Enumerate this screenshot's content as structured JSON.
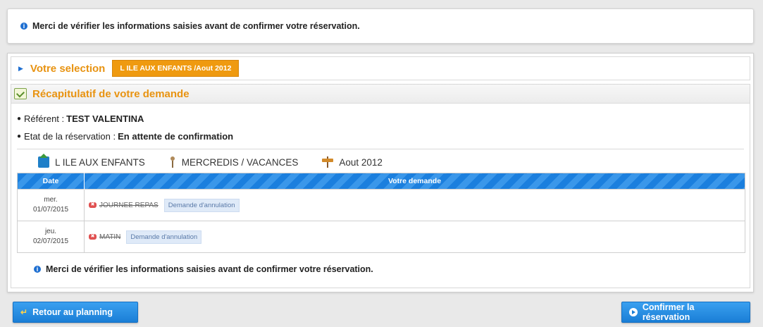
{
  "notices": {
    "top": "Merci de vérifier les informations saisies avant de confirmer votre réservation.",
    "bottom": "Merci de vérifier les informations saisies avant de confirmer votre réservation."
  },
  "selection": {
    "label": "Votre selection",
    "badge": "L ILE AUX ENFANTS /Aout 2012"
  },
  "recap": {
    "title": "Récapitulatif de votre demande",
    "referent_label": "Référent :",
    "referent_value": "TEST VALENTINA",
    "etat_label": "Etat de la réservation :",
    "etat_value": "En attente de confirmation"
  },
  "activity": {
    "structure": "L ILE AUX ENFANTS",
    "type": "MERCREDIS / VACANCES",
    "period": "Aout 2012"
  },
  "table": {
    "headers": [
      "Date",
      "Votre demande"
    ],
    "rows": [
      {
        "day": "mer.",
        "date": "01/07/2015",
        "item": "JOURNEE REPAS",
        "status": "Demande d'annulation"
      },
      {
        "day": "jeu.",
        "date": "02/07/2015",
        "item": "MATIN",
        "status": "Demande d'annulation"
      }
    ]
  },
  "buttons": {
    "back": "Retour au planning",
    "confirm": "Confirmer la réservation"
  },
  "colors": {
    "accent_orange": "#e89311",
    "primary_blue": "#1a7ed6"
  },
  "icons": {
    "info": "info-icon",
    "recap": "checklist-icon",
    "structure": "house-icon",
    "type": "person-icon",
    "period": "signpost-icon",
    "cancel": "remove-icon",
    "back": "back-arrow-icon",
    "confirm": "play-circle-icon"
  }
}
